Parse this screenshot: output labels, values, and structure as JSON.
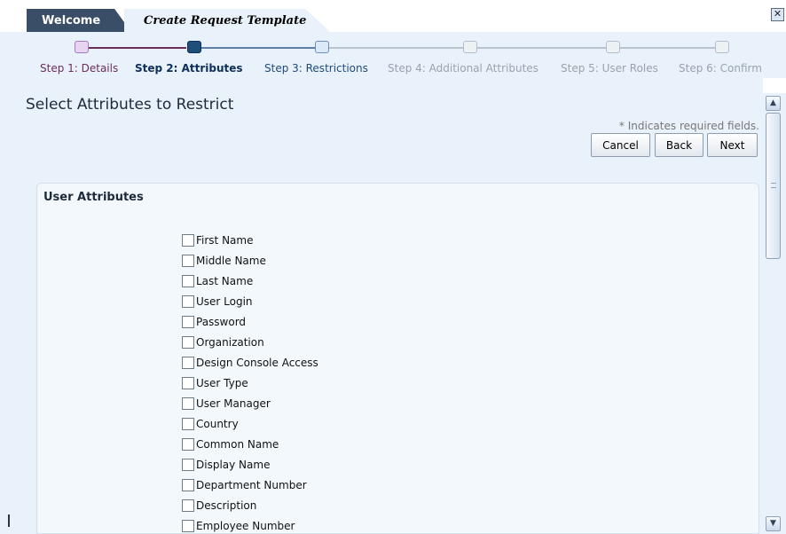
{
  "tabs": [
    {
      "label": "Welcome"
    },
    {
      "label": "Create Request Template"
    }
  ],
  "close_icon": "close-x-icon",
  "train": {
    "steps": [
      {
        "label": "Step 1: Details",
        "state": "visited",
        "color": "#6b2d5c"
      },
      {
        "label": "Step 2: Attributes",
        "state": "current",
        "color": "#0d2f5a"
      },
      {
        "label": "Step 3: Restrictions",
        "state": "next",
        "color": "#1e4b7c"
      },
      {
        "label": "Step 4: Additional Attributes",
        "state": "unvisited",
        "color": "#9aa3ad"
      },
      {
        "label": "Step 5: User Roles",
        "state": "unvisited",
        "color": "#9aa3ad"
      },
      {
        "label": "Step 6: Confirm",
        "state": "unvisited",
        "color": "#9aa3ad"
      }
    ]
  },
  "page": {
    "title": "Select Attributes to Restrict",
    "required_note": "* Indicates required fields."
  },
  "buttons": {
    "cancel": "Cancel",
    "back": "Back",
    "next": "Next"
  },
  "panel": {
    "header": "User Attributes",
    "attributes": [
      {
        "label": "First Name",
        "checked": false
      },
      {
        "label": "Middle Name",
        "checked": false
      },
      {
        "label": "Last Name",
        "checked": false
      },
      {
        "label": "User Login",
        "checked": false
      },
      {
        "label": "Password",
        "checked": false
      },
      {
        "label": "Organization",
        "checked": false
      },
      {
        "label": "Design Console Access",
        "checked": false
      },
      {
        "label": "User Type",
        "checked": false
      },
      {
        "label": "User Manager",
        "checked": false
      },
      {
        "label": "Country",
        "checked": false
      },
      {
        "label": "Common Name",
        "checked": false
      },
      {
        "label": "Display Name",
        "checked": false
      },
      {
        "label": "Department Number",
        "checked": false
      },
      {
        "label": "Description",
        "checked": false
      },
      {
        "label": "Employee Number",
        "checked": false
      }
    ]
  },
  "colors": {
    "background": "#e9f1fa",
    "tab_dark": "#3b4e67",
    "current_step": "#0d2f5a"
  }
}
